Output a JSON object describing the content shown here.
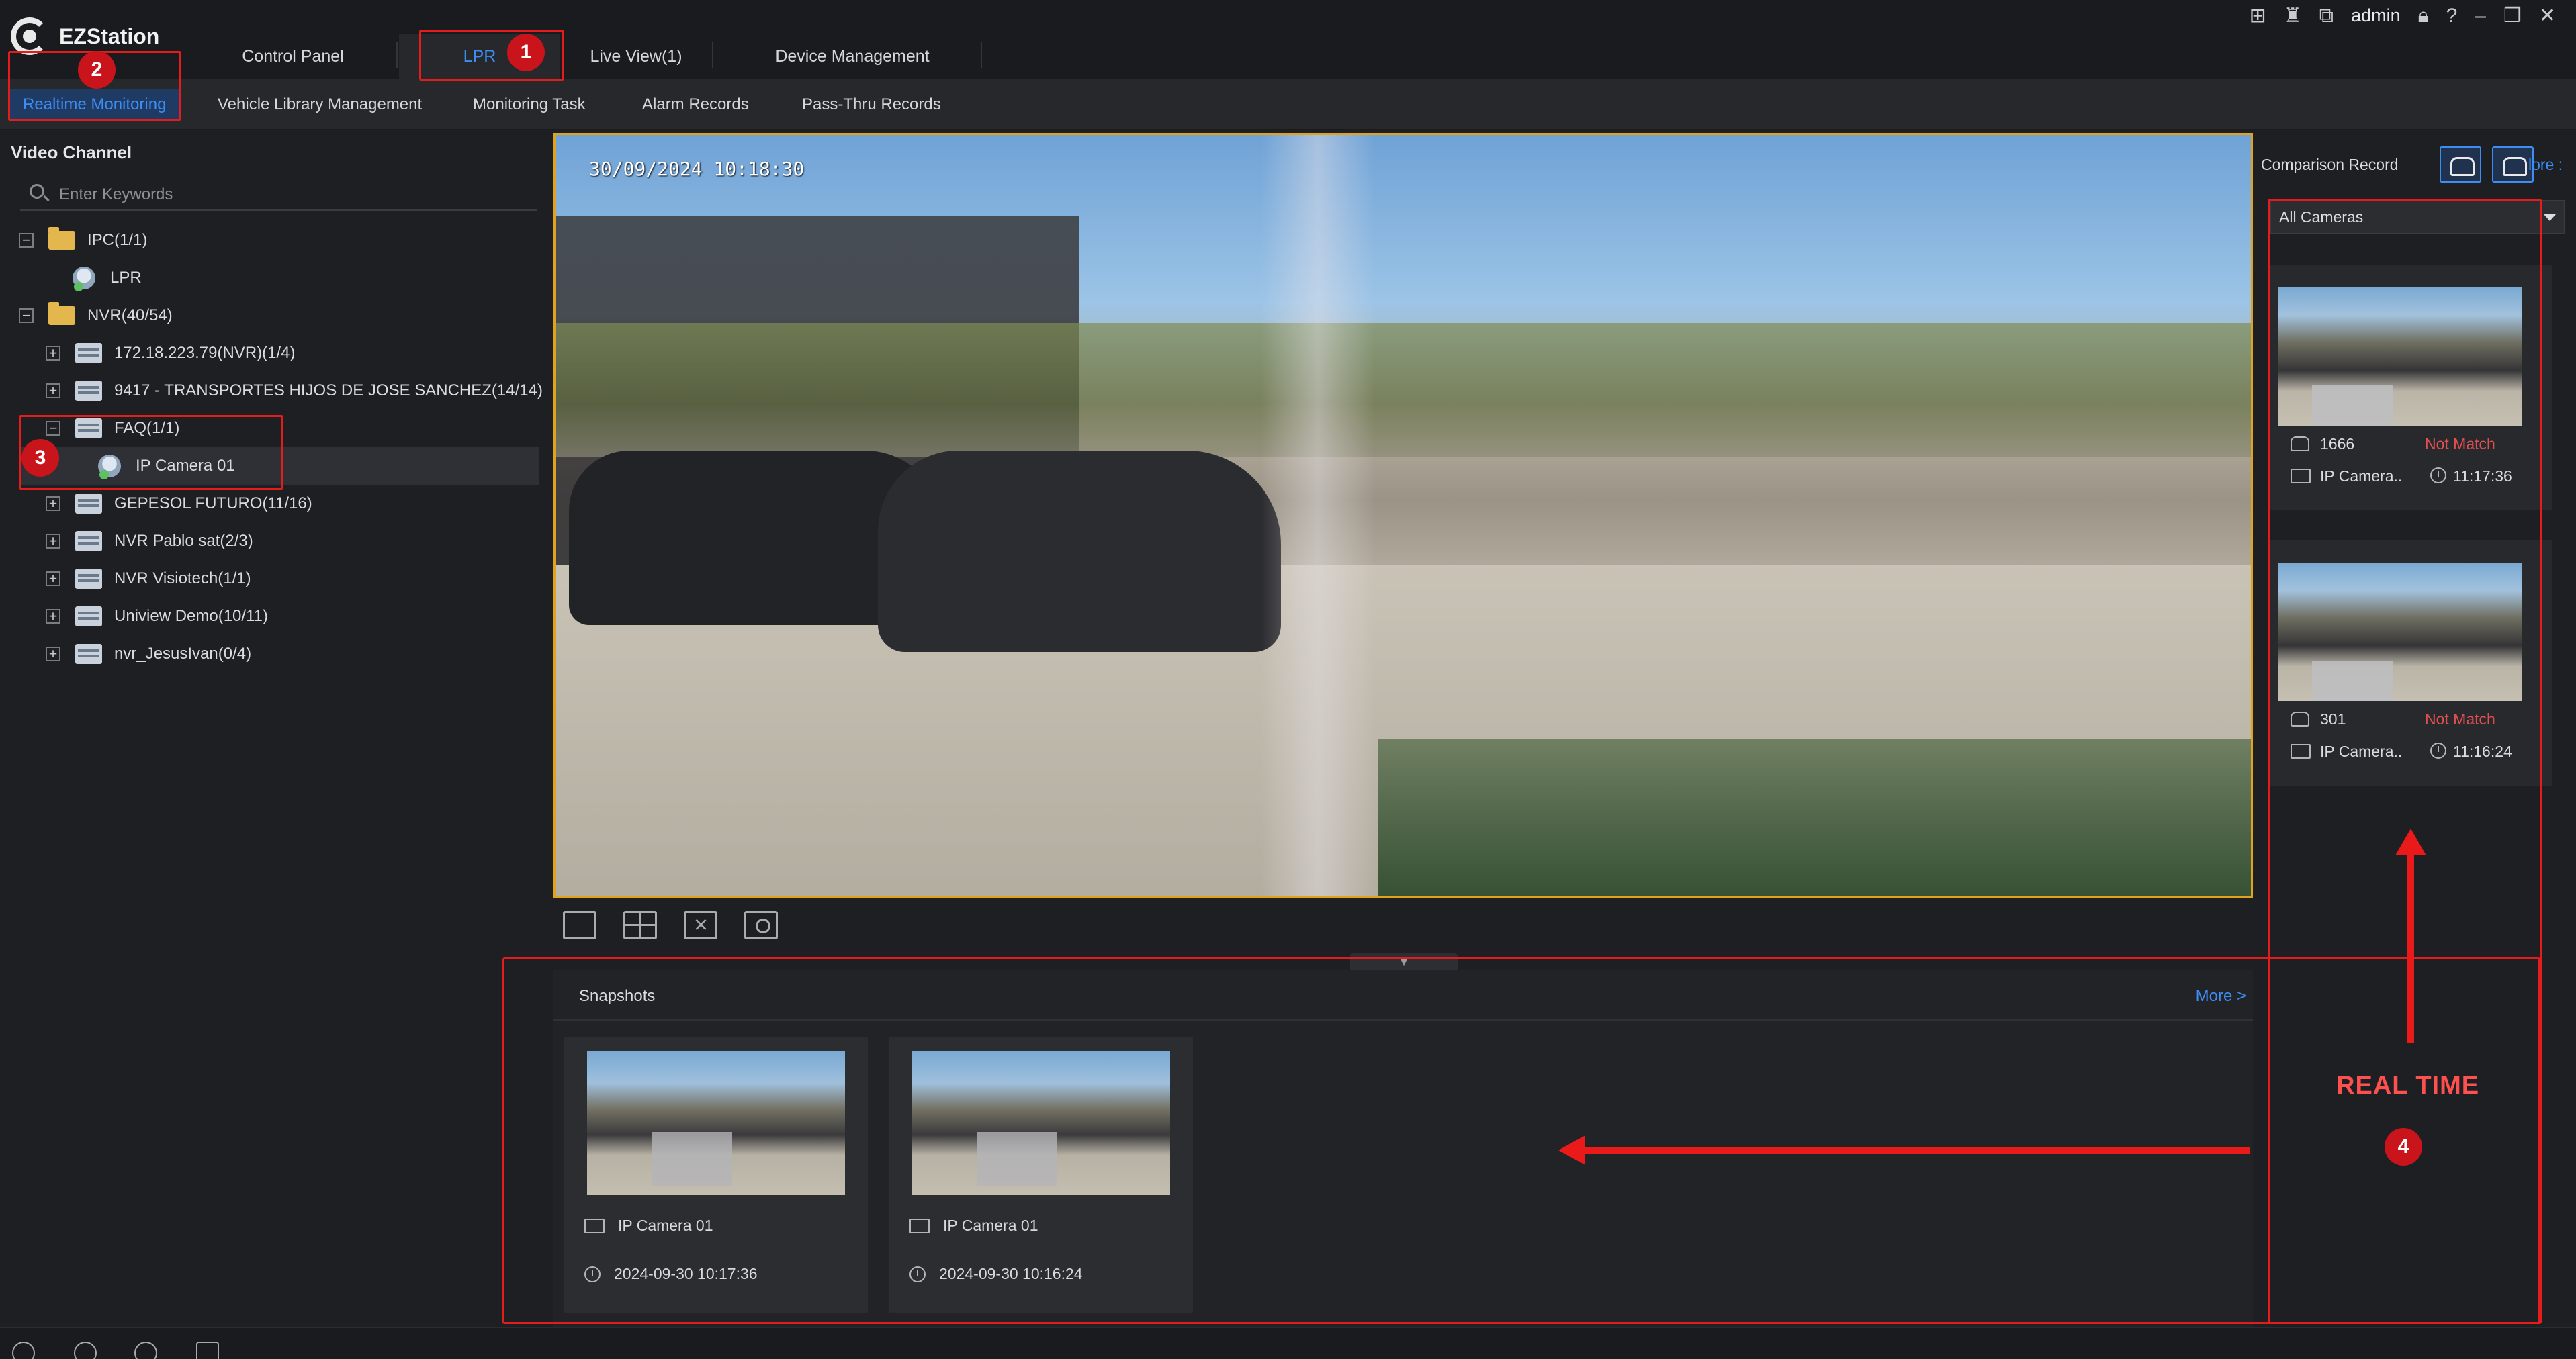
{
  "app": {
    "name": "EZStation",
    "user": "admin"
  },
  "main_tabs": [
    {
      "label": "Control Panel"
    },
    {
      "label": "LPR"
    },
    {
      "label": "Live View(1)"
    },
    {
      "label": "Device Management"
    }
  ],
  "sub_tabs": [
    {
      "label": "Realtime Monitoring"
    },
    {
      "label": "Vehicle Library Management"
    },
    {
      "label": "Monitoring Task"
    },
    {
      "label": "Alarm Records"
    },
    {
      "label": "Pass-Thru Records"
    }
  ],
  "video_channel": {
    "title": "Video Channel",
    "search_placeholder": "Enter Keywords",
    "tree": [
      {
        "label": "IPC(1/1)"
      },
      {
        "label": "LPR"
      },
      {
        "label": "NVR(40/54)"
      },
      {
        "label": "172.18.223.79(NVR)(1/4)"
      },
      {
        "label": "9417 - TRANSPORTES HIJOS DE JOSE SANCHEZ(14/14)"
      },
      {
        "label": "FAQ(1/1)"
      },
      {
        "label": "IP Camera 01"
      },
      {
        "label": "GEPESOL FUTURO(11/16)"
      },
      {
        "label": "NVR Pablo sat(2/3)"
      },
      {
        "label": "NVR Visiotech(1/1)"
      },
      {
        "label": "Uniview Demo(10/11)"
      },
      {
        "label": "nvr_JesusIvan(0/4)"
      }
    ]
  },
  "video": {
    "timestamp": "30/09/2024 10:18:30"
  },
  "snapshots": {
    "title": "Snapshots",
    "more": "More >",
    "items": [
      {
        "camera": "IP Camera 01",
        "time": "2024-09-30 10:17:36"
      },
      {
        "camera": "IP Camera 01",
        "time": "2024-09-30 10:16:24"
      }
    ]
  },
  "comparison": {
    "title": "Comparison Record",
    "more": "lore :",
    "camera_filter": "All Cameras",
    "records": [
      {
        "plate": "1666",
        "status": "Not Match",
        "camera": "IP Camera..",
        "time": "11:17:36"
      },
      {
        "plate": "301",
        "status": "Not Match",
        "camera": "IP Camera..",
        "time": "11:16:24"
      }
    ]
  },
  "annotations": {
    "n1": "1",
    "n2": "2",
    "n3": "3",
    "n4": "4",
    "real_time": "REAL TIME"
  },
  "colors": {
    "accent": "#3d8df5",
    "annotation": "#e51c1c",
    "not_match": "#e25050",
    "video_border": "#e0a31b"
  }
}
